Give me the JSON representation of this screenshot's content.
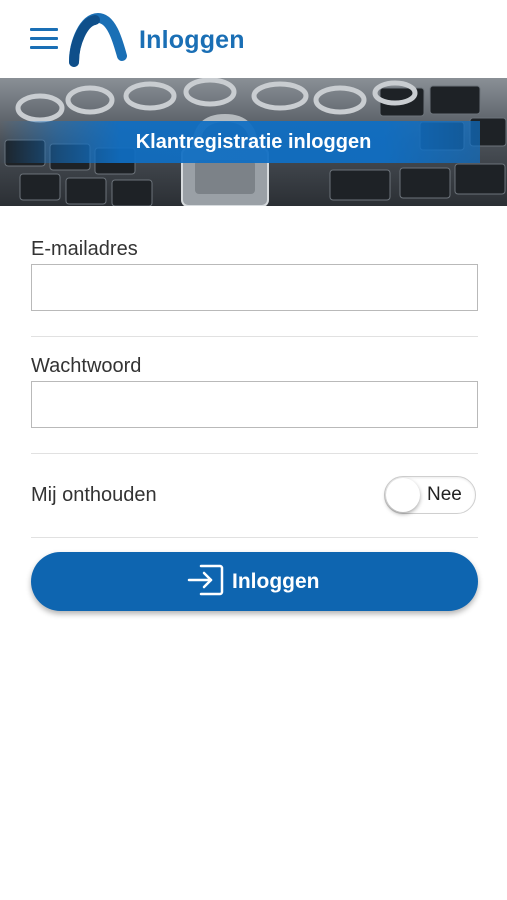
{
  "header": {
    "menu_icon": "hamburger-menu-icon",
    "logo_icon": "brand-arch-logo",
    "title": "Inloggen",
    "brand_color": "#1a6fb5"
  },
  "banner": {
    "title": "Klantregistratie inloggen",
    "image": "keyboard-chain-padlock-photo",
    "strip_color": "#0f6ec3"
  },
  "form": {
    "email": {
      "label": "E-mailadres",
      "value": "",
      "placeholder": ""
    },
    "password": {
      "label": "Wachtwoord",
      "value": "",
      "placeholder": ""
    },
    "remember": {
      "label": "Mij onthouden",
      "toggle_text": "Nee",
      "checked": false
    },
    "submit": {
      "label": "Inloggen",
      "icon": "sign-in-icon",
      "color": "#0e65b0"
    }
  }
}
